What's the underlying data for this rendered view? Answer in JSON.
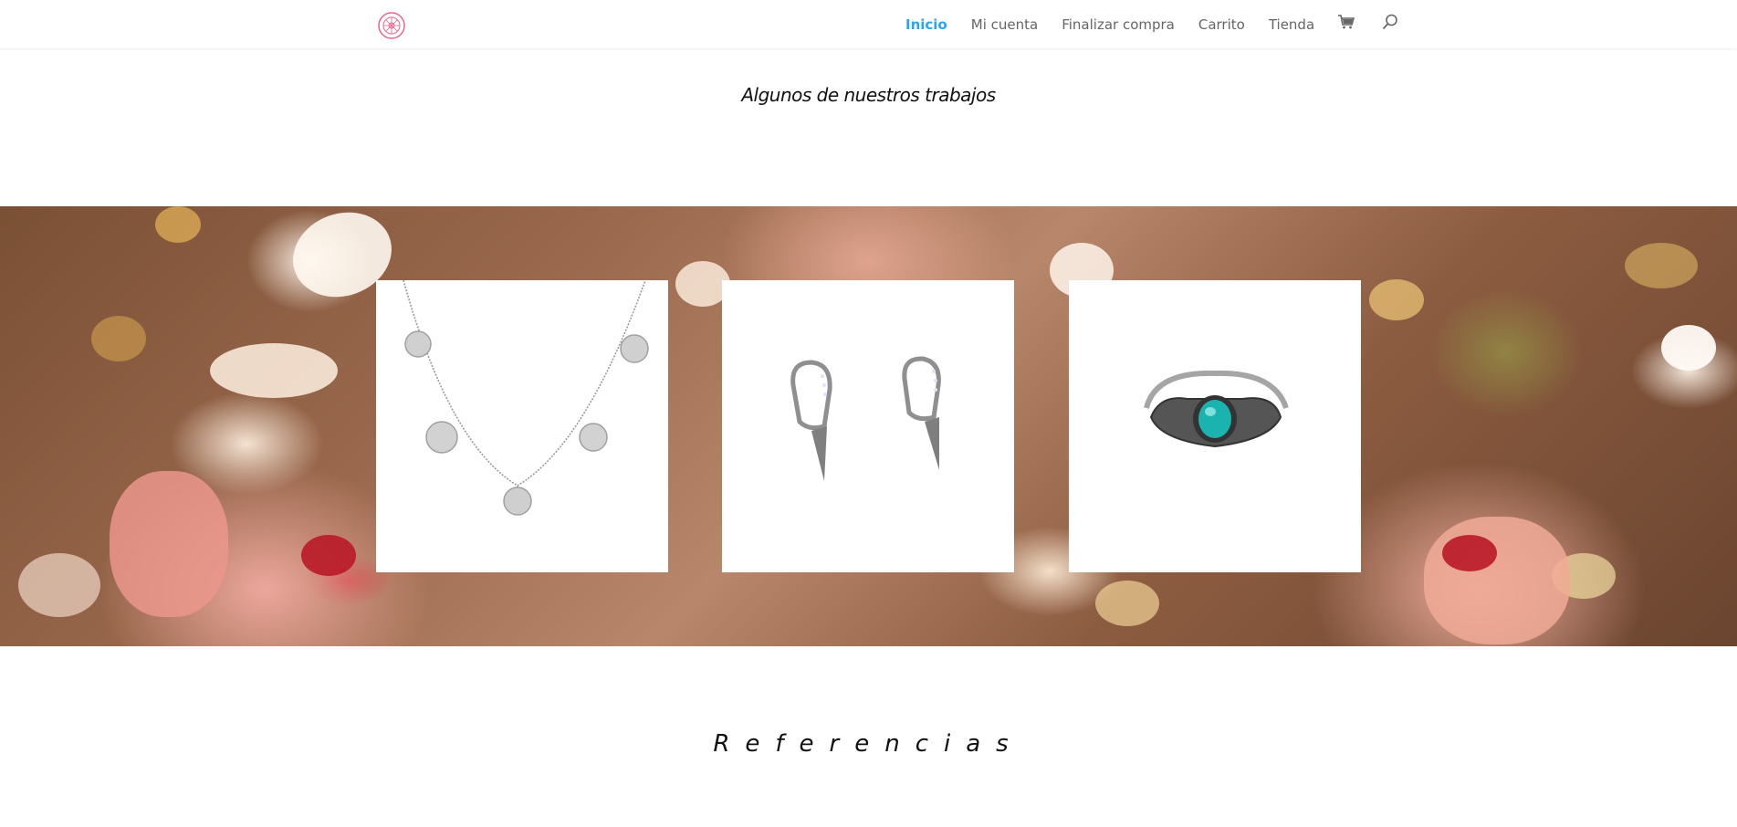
{
  "header": {
    "nav": {
      "inicio": "Inicio",
      "mi_cuenta": "Mi cuenta",
      "finalizar_compra": "Finalizar compra",
      "carrito": "Carrito",
      "tienda": "Tienda"
    },
    "icons": [
      "logo-icon",
      "cart-icon",
      "search-icon"
    ],
    "active_color": "#2ea3f2"
  },
  "main": {
    "section_title": "Algunos de nuestros trabajos",
    "gallery": [
      "necklace",
      "earrings",
      "ring"
    ]
  },
  "references": {
    "title": "Referencias"
  }
}
